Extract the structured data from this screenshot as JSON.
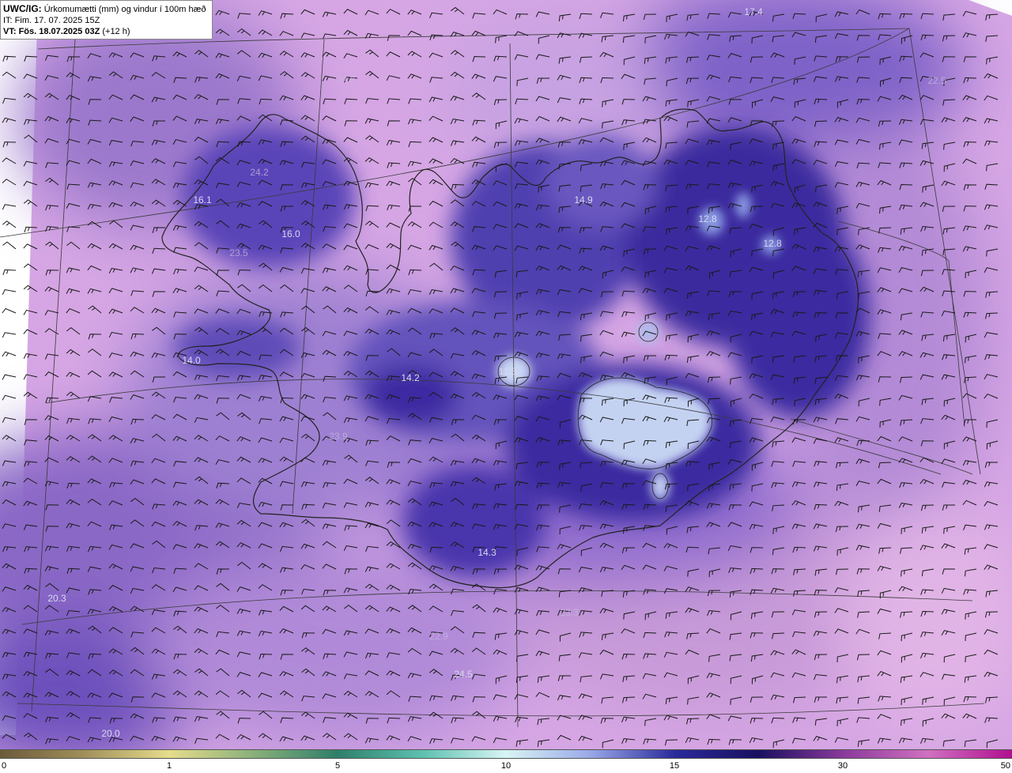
{
  "header": {
    "product": "UWC/IG:",
    "description": " Úrkomumætti (mm) og vindur í 100m hæð",
    "issue_time": "IT: Fim. 17. 07. 2025 15Z",
    "valid_prefix": "VT: ",
    "valid_time": "Fös. 18.07.2025 03Z",
    "lead": " (+12 h)"
  },
  "labels": [
    {
      "text": "17.4",
      "tone": "light"
    },
    {
      "text": "24.6",
      "tone": "dim"
    },
    {
      "text": "22.5",
      "tone": "dim"
    },
    {
      "text": "24.2",
      "tone": "dim"
    },
    {
      "text": "16.1",
      "tone": "light"
    },
    {
      "text": "16.0",
      "tone": "light"
    },
    {
      "text": "23.5",
      "tone": "dim"
    },
    {
      "text": "14.9",
      "tone": "light"
    },
    {
      "text": "12.8",
      "tone": "light"
    },
    {
      "text": "12.8",
      "tone": "light"
    },
    {
      "text": "14.0",
      "tone": "light"
    },
    {
      "text": "14.2",
      "tone": "light"
    },
    {
      "text": "11.5",
      "tone": "light"
    },
    {
      "text": "23.9",
      "tone": "dim"
    },
    {
      "text": "14.3",
      "tone": "light"
    },
    {
      "text": "20.3",
      "tone": "light"
    },
    {
      "text": "22.9",
      "tone": "dim"
    },
    {
      "text": "23.3",
      "tone": "dim"
    },
    {
      "text": "24.5",
      "tone": "light"
    },
    {
      "text": "20.0",
      "tone": "light"
    }
  ],
  "colorbar": {
    "ticks": [
      "0",
      "1",
      "5",
      "10",
      "15",
      "30",
      "50"
    ],
    "colors": [
      "#6b5a3a",
      "#a08f5a",
      "#e6dc8c",
      "#8ab07a",
      "#2f7f6a",
      "#5cc0b0",
      "#d8f4f4",
      "#9aa8e8",
      "#2a2a9a",
      "#1a1060",
      "#8a3a9a",
      "#d070c0",
      "#b01090"
    ]
  },
  "colors": {
    "background_light": "#d8a8e4",
    "background_mid": "#a07cd0",
    "land_low": "#5a48b4",
    "land_dark": "#2a1c8c",
    "glacier_light": "#c8d8f0",
    "coastline": "#222222",
    "wind_barb": "#1a1a1a"
  }
}
